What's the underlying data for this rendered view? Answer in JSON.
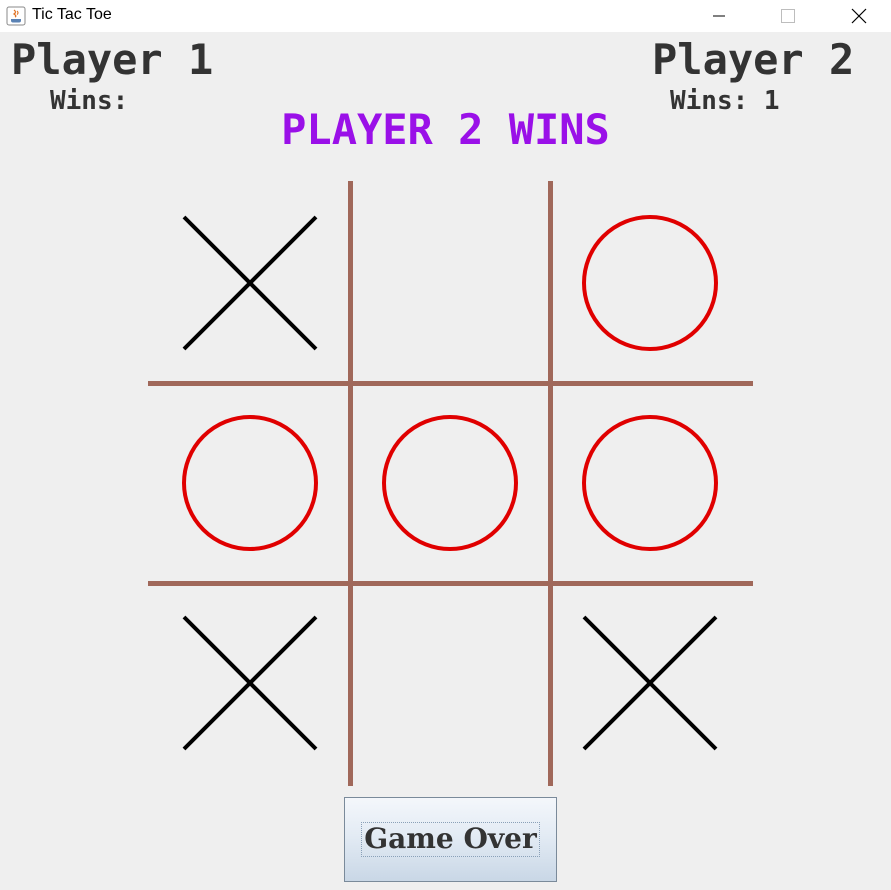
{
  "window": {
    "title": "Tic Tac Toe"
  },
  "players": {
    "p1": {
      "name": "Player 1",
      "wins_label": "Wins:",
      "wins_value": ""
    },
    "p2": {
      "name": "Player 2",
      "wins_label": "Wins: 1",
      "wins_value": "1"
    }
  },
  "status_text": "PLAYER 2 WINS",
  "board": {
    "cells": [
      "X",
      "",
      "O",
      "O",
      "O",
      "O",
      "X",
      "",
      "X"
    ],
    "colors": {
      "x": "#000000",
      "o": "#e00000",
      "grid": "#a0685a"
    }
  },
  "button": {
    "label": "Game Over"
  },
  "colors": {
    "status": "#9a10e8",
    "text": "#333333"
  }
}
